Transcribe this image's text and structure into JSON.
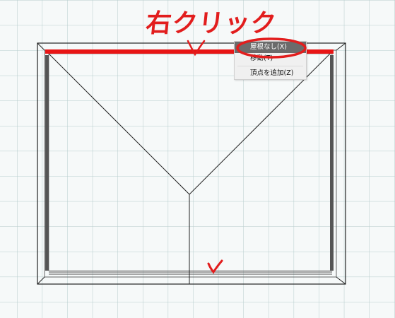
{
  "annotation": {
    "label": "右クリック",
    "color": "#e21d1d"
  },
  "context_menu": {
    "items": [
      {
        "label": "屋根なし(X)",
        "highlighted": true
      },
      {
        "label": "移動(T)",
        "highlighted": false
      },
      {
        "label": "頂点を追加(Z)",
        "highlighted": false
      }
    ]
  },
  "colors": {
    "grid": "#b5cccc",
    "background": "#f6f9f9",
    "selected_edge": "#e81515",
    "menu_highlight": "#6b6b6b"
  }
}
